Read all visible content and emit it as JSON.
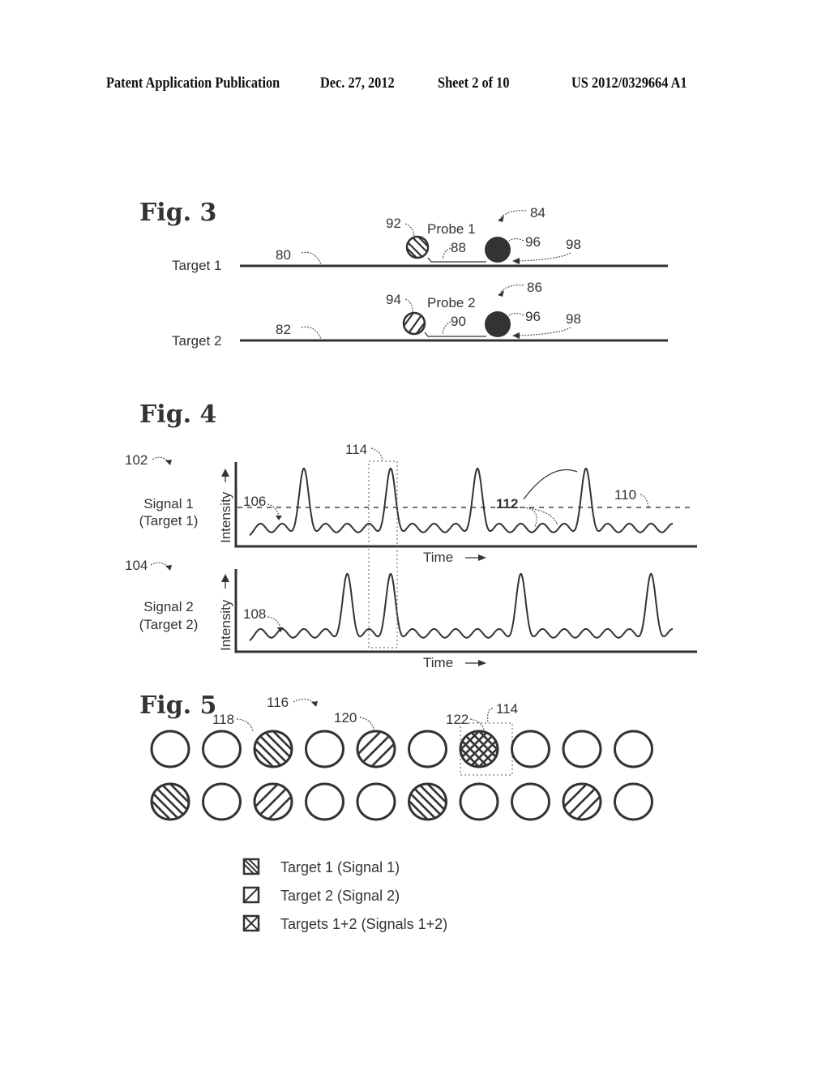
{
  "header": {
    "publication": "Patent Application Publication",
    "date": "Dec. 27, 2012",
    "sheet": "Sheet 2 of 10",
    "number": "US 2012/0329664 A1"
  },
  "fig3": {
    "title": "Fig. 3",
    "rows": [
      {
        "target_label": "Target 1",
        "target_ref": "80",
        "probe_label": "Probe 1",
        "probe_ref": "84",
        "fluor_ref": "92",
        "fluor_pattern": "hatch-down",
        "linker_ref": "88",
        "quencher_ref": "96",
        "arrow_ref": "98"
      },
      {
        "target_label": "Target 2",
        "target_ref": "82",
        "probe_label": "Probe 2",
        "probe_ref": "86",
        "fluor_ref": "94",
        "fluor_pattern": "hatch-up",
        "linker_ref": "90",
        "quencher_ref": "96",
        "arrow_ref": "98"
      }
    ]
  },
  "fig4": {
    "title": "Fig. 4",
    "window_ref": "114",
    "panels": [
      {
        "ref": "102",
        "signal_label": "Signal 1",
        "target_label": "(Target 1)",
        "y_axis": "Intensity",
        "x_axis": "Time",
        "baseline_ref": "106",
        "threshold_ref": "110",
        "peaks_ref": "112",
        "peaks": [
          0,
          0,
          1,
          0,
          0,
          0,
          1,
          0,
          0,
          0,
          1,
          0,
          0,
          0,
          0,
          1,
          0,
          0,
          0,
          0
        ]
      },
      {
        "ref": "104",
        "signal_label": "Signal 2",
        "target_label": "(Target 2)",
        "y_axis": "Intensity",
        "x_axis": "Time",
        "baseline_ref": "108",
        "peaks": [
          0,
          0,
          0,
          0,
          1,
          0,
          1,
          0,
          0,
          0,
          0,
          0,
          1,
          0,
          0,
          0,
          0,
          0,
          1,
          0
        ]
      }
    ]
  },
  "fig5": {
    "title": "Fig. 5",
    "array_ref": "116",
    "refs": {
      "target1": "118",
      "target2": "120",
      "both": "122",
      "window": "114"
    },
    "wells": [
      [
        "empty",
        "empty",
        "t1",
        "empty",
        "t2",
        "empty",
        "both",
        "empty",
        "empty",
        "empty"
      ],
      [
        "t1",
        "empty",
        "t2",
        "empty",
        "empty",
        "t1",
        "empty",
        "empty",
        "t2",
        "empty"
      ]
    ],
    "legend": [
      {
        "pattern": "t1",
        "label": "Target 1 (Signal 1)"
      },
      {
        "pattern": "t2",
        "label": "Target 2 (Signal 2)"
      },
      {
        "pattern": "both",
        "label": "Targets 1+2 (Signals 1+2)"
      }
    ]
  }
}
